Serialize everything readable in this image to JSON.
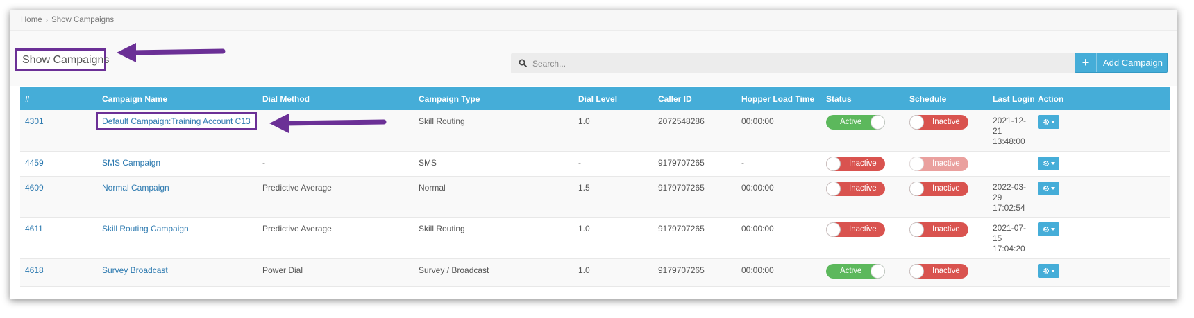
{
  "breadcrumb": {
    "home": "Home",
    "separator": "›",
    "current": "Show Campaigns"
  },
  "header": {
    "title": "Show Campaigns",
    "search": {
      "placeholder": "Search...",
      "value": ""
    },
    "add_button": {
      "icon": "+",
      "label": "Add Campaign"
    }
  },
  "table": {
    "columns": [
      "#",
      "Campaign Name",
      "Dial Method",
      "Campaign Type",
      "Dial Level",
      "Caller ID",
      "Hopper Load Time",
      "Status",
      "Schedule",
      "Last Login",
      "Action"
    ],
    "rows": [
      {
        "id": "4301",
        "name": "Default Campaign:Training Account C13",
        "dial_method": "",
        "type": "Skill Routing",
        "dial_level": "1.0",
        "caller_id": "2072548286",
        "hopper": "00:00:00",
        "status": "Active",
        "schedule": "Inactive",
        "last_login": "2021-12-\n21\n13:48:00"
      },
      {
        "id": "4459",
        "name": "SMS Campaign",
        "dial_method": "-",
        "type": "SMS",
        "dial_level": "-",
        "caller_id": "9179707265",
        "hopper": "-",
        "status": "Inactive",
        "schedule": "Inactive",
        "last_login": ""
      },
      {
        "id": "4609",
        "name": "Normal Campaign",
        "dial_method": "Predictive Average",
        "type": "Normal",
        "dial_level": "1.5",
        "caller_id": "9179707265",
        "hopper": "00:00:00",
        "status": "Inactive",
        "schedule": "Inactive",
        "last_login": "2022-03-\n29\n17:02:54"
      },
      {
        "id": "4611",
        "name": "Skill Routing Campaign",
        "dial_method": "Predictive Average",
        "type": "Skill Routing",
        "dial_level": "1.0",
        "caller_id": "9179707265",
        "hopper": "00:00:00",
        "status": "Inactive",
        "schedule": "Inactive",
        "last_login": "2021-07-\n15\n17:04:20"
      },
      {
        "id": "4618",
        "name": "Survey Broadcast",
        "dial_method": "Power Dial",
        "type": "Survey / Broadcast",
        "dial_level": "1.0",
        "caller_id": "9179707265",
        "hopper": "00:00:00",
        "status": "Active",
        "schedule": "Inactive",
        "last_login": ""
      }
    ]
  },
  "colors": {
    "header_blue": "#45add8",
    "link_blue": "#2d7ab0",
    "active_green": "#5cb85c",
    "inactive_red": "#d9534f",
    "annotation_purple": "#6b3096"
  },
  "icons": [
    "search-icon",
    "plus-icon",
    "gear-icon",
    "caret-down-icon",
    "arrow-left-icon"
  ]
}
